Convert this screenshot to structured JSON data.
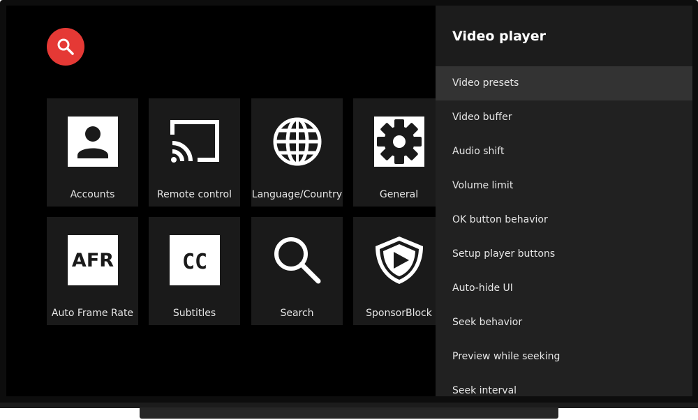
{
  "tiles": [
    {
      "label": "Accounts",
      "icon": "account-icon"
    },
    {
      "label": "Remote control",
      "icon": "cast-icon"
    },
    {
      "label": "Language/Country",
      "icon": "globe-icon"
    },
    {
      "label": "General",
      "icon": "gear-icon"
    },
    {
      "label": "Auto Frame Rate",
      "icon": "afr-icon",
      "icon_text": "AFR"
    },
    {
      "label": "Subtitles",
      "icon": "cc-icon",
      "icon_text": "CC"
    },
    {
      "label": "Search",
      "icon": "magnifier-icon"
    },
    {
      "label": "SponsorBlock",
      "icon": "sponsorblock-icon"
    }
  ],
  "panel": {
    "title": "Video player",
    "selected_index": 0,
    "items": [
      "Video presets",
      "Video buffer",
      "Audio shift",
      "Volume limit",
      "OK button behavior",
      "Setup player buttons",
      "Auto-hide UI",
      "Seek behavior",
      "Preview while seeking",
      "Seek interval"
    ]
  },
  "colors": {
    "accent": "#e53935",
    "screen": "#000000",
    "tile": "#1a1a1a",
    "panel": "#212121",
    "selected": "#333333"
  }
}
